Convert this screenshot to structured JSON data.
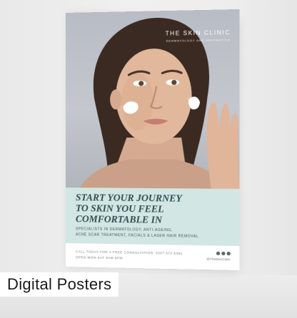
{
  "poster": {
    "clinic_name": "THE SKIN CLINIC",
    "clinic_tagline": "DERMATOLOGY AND AESTHETICS",
    "headline_line1": "START YOUR JOURNEY",
    "headline_line2": "TO SKIN YOU FEEL",
    "headline_line3": "COMFORTABLE IN",
    "subtext_line1": "SPECIALISTS IN DERMATOLOGY, ANTI-AGEING,",
    "subtext_line2": "ACNE SCAR TREATMENT, FACIALS & LASER HAIR REMOVAL",
    "contact_line1": "CALL TODAY FOR A FREE CONSULTATION: 0207 572 6481",
    "contact_line2": "OPEN MON-SAT 9AM-6PM",
    "social_handle": "@TheSkinClinic"
  },
  "caption": {
    "label": "Digital Posters"
  },
  "colors": {
    "panel": "#d2e6e3",
    "headline": "#2f4f54",
    "wall": "#ececec"
  }
}
